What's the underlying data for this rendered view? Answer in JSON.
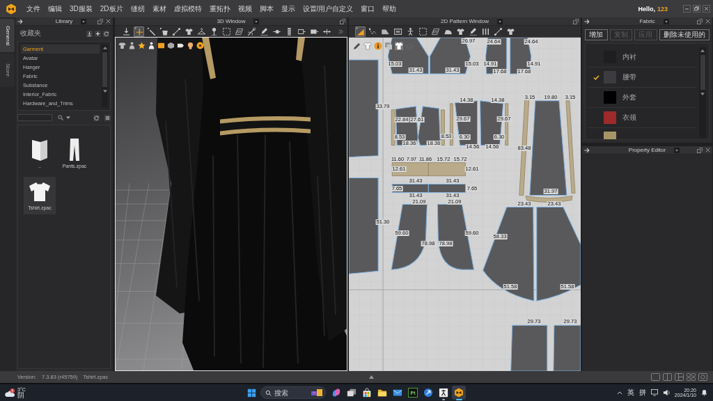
{
  "menu_bar": {
    "items": [
      "文件",
      "编辑",
      "3D服装",
      "2D板片",
      "缝纫",
      "素材",
      "虚拟模特",
      "重拓扑",
      "视频",
      "脚本",
      "显示",
      "设置/用户自定义",
      "窗口",
      "帮助"
    ],
    "greeting": "Hello,",
    "user": "123"
  },
  "side_tabs": [
    {
      "label": "General",
      "selected": true
    },
    {
      "label": "Store",
      "selected": false
    }
  ],
  "library": {
    "title": "Library",
    "favorites": "收藏夹",
    "categories": [
      {
        "label": "Garment",
        "selected": true
      },
      {
        "label": "Avatar",
        "selected": false
      },
      {
        "label": "Hanger",
        "selected": false
      },
      {
        "label": "Fabric",
        "selected": false
      },
      {
        "label": "Substance",
        "selected": false
      },
      {
        "label": "Interior_Fabric",
        "selected": false
      },
      {
        "label": "Hardware_and_Trims",
        "selected": false
      }
    ],
    "files": [
      {
        "name": "..",
        "kind": "folder",
        "selected": false
      },
      {
        "name": "Pants.zpac",
        "kind": "pants",
        "selected": false
      },
      {
        "name": "Tshirt.zpac",
        "kind": "tshirt",
        "selected": true
      }
    ]
  },
  "window_3d": {
    "title": "3D Window",
    "tools": [
      {
        "kind": "select",
        "selected": false
      },
      {
        "kind": "move",
        "selected": true
      },
      {
        "kind": "pen",
        "selected": false
      },
      {
        "kind": "bucket",
        "selected": false
      },
      {
        "kind": "line",
        "selected": false
      },
      {
        "kind": "shirt",
        "selected": false
      },
      {
        "kind": "hanger",
        "selected": false
      },
      {
        "kind": "pin",
        "selected": false
      },
      {
        "kind": "dashed",
        "selected": false
      },
      {
        "kind": "hatch",
        "selected": false
      },
      {
        "kind": "needle",
        "selected": false
      },
      {
        "kind": "marker",
        "selected": false
      },
      {
        "kind": "dot",
        "selected": false
      },
      {
        "kind": "zipper",
        "selected": false
      },
      {
        "kind": "tag",
        "selected": false
      },
      {
        "kind": "box",
        "selected": false
      },
      {
        "kind": "ruler",
        "selected": false
      }
    ]
  },
  "window_2d": {
    "title": "2D Pattern Window",
    "tools": [
      {
        "kind": "triangle",
        "selected": true
      },
      {
        "kind": "polygon",
        "selected": false
      },
      {
        "kind": "piece",
        "selected": false
      },
      {
        "kind": "frame",
        "selected": false
      },
      {
        "kind": "figure",
        "selected": false
      },
      {
        "kind": "dashed",
        "selected": false
      },
      {
        "kind": "hatch",
        "selected": false
      },
      {
        "kind": "iron",
        "selected": false
      },
      {
        "kind": "shirt",
        "selected": false
      },
      {
        "kind": "marker",
        "selected": false
      },
      {
        "kind": "bars",
        "selected": false
      },
      {
        "kind": "line",
        "selected": false
      },
      {
        "kind": "shirt",
        "selected": false
      }
    ],
    "measurements": [
      "26.97",
      "24.64",
      "24.64",
      "15.03",
      "31.43",
      "31.43",
      "15.03",
      "14.91",
      "14.91",
      "17.68",
      "17.68",
      "33.79",
      "22.84",
      "27.61",
      "8.53",
      "8.53",
      "18.36",
      "18.36",
      "14.38",
      "14.38",
      "29.67",
      "29.67",
      "6.30",
      "6.30",
      "14.56",
      "14.56",
      "3.15",
      "19.80",
      "3.15",
      "83.48",
      "11.60",
      "7.97",
      "11.86",
      "15.72",
      "15.72",
      "12.61",
      "12.61",
      "31.43",
      "31.43",
      "7.65",
      "7.65",
      "31.43",
      "31.43",
      "31.97",
      "21.09",
      "21.09",
      "23.43",
      "23.43",
      "51.30",
      "59.60",
      "59.60",
      "78.98",
      "78.98",
      "58.33",
      "51.58",
      "51.58",
      "29.73",
      "29.73"
    ]
  },
  "fabric": {
    "title": "Fabric",
    "buttons": [
      {
        "label": "增加",
        "disabled": false
      },
      {
        "label": "复制",
        "disabled": true
      },
      {
        "label": "应用",
        "disabled": true
      },
      {
        "label": "删除未使用的",
        "disabled": false
      }
    ],
    "items": [
      {
        "name": "内衬",
        "color": "#1e1e1e",
        "selected": false
      },
      {
        "name": "腰带",
        "color": "#3b3b40",
        "selected": true
      },
      {
        "name": "外套",
        "color": "#000000",
        "selected": false
      },
      {
        "name": "衣领",
        "color": "#9e2a2b",
        "selected": false
      },
      {
        "color": "#a89466",
        "selected": false
      }
    ]
  },
  "property_editor": {
    "title": "Property Editor"
  },
  "status_bar": {
    "version_label": "Version:",
    "version": "7.3.83 (r45759)",
    "file": "Tshirt.zpac"
  },
  "taskbar": {
    "weather": {
      "temperature": "3°C",
      "condition": "阴"
    },
    "search": {
      "placeholder": "搜索"
    },
    "apps": [
      {
        "kind": "swirl",
        "running": false,
        "selected": false
      },
      {
        "kind": "windows",
        "running": false,
        "selected": false
      },
      {
        "kind": "bag",
        "running": false,
        "selected": false
      },
      {
        "kind": "folder",
        "running": false,
        "selected": false
      },
      {
        "kind": "mail",
        "running": false,
        "selected": false
      },
      {
        "kind": "tile",
        "label": "Pt",
        "running": false,
        "selected": false
      },
      {
        "kind": "arrow",
        "running": false,
        "selected": false
      },
      {
        "kind": "sketch",
        "running": true,
        "selected": false
      },
      {
        "kind": "hexagon",
        "running": true,
        "selected": true
      }
    ],
    "tray": {
      "input_mode": "英",
      "input_method": "拼",
      "time": "20:20",
      "date": "2024/1/10"
    }
  }
}
